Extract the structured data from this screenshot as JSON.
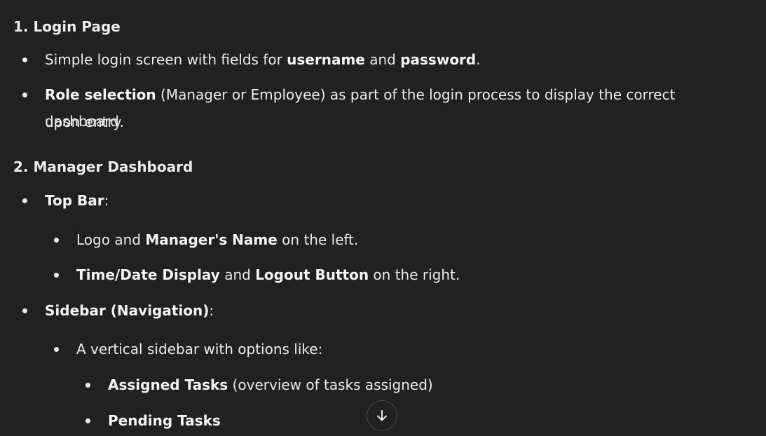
{
  "sections": [
    {
      "heading": "1. Login Page",
      "items": [
        {
          "pre": "Simple login screen with fields for ",
          "b1": "username",
          "mid": " and ",
          "b2": "password",
          "post": "."
        },
        {
          "b1": "Role selection",
          "post": " (Manager or Employee) as part of the login process to display the correct dashboard",
          "wrap": "upon entry."
        }
      ]
    },
    {
      "heading": "2. Manager Dashboard",
      "top_bar": {
        "b": "Top Bar",
        "post": ":"
      },
      "top_bar_items": [
        {
          "pre": "Logo and ",
          "b": "Manager's Name",
          "post": " on the left."
        },
        {
          "b1": "Time/Date Display",
          "mid": " and ",
          "b2": "Logout Button",
          "post": " on the right."
        }
      ],
      "sidebar": {
        "b": "Sidebar (Navigation)",
        "post": ":"
      },
      "sidebar_intro": "A vertical sidebar with options like:",
      "sidebar_options": [
        {
          "b": "Assigned Tasks",
          "post": " (overview of tasks assigned)"
        },
        {
          "b": "Pending Tasks",
          "post": ""
        }
      ]
    }
  ],
  "scroll_button": {
    "icon": "arrow-down-icon"
  }
}
